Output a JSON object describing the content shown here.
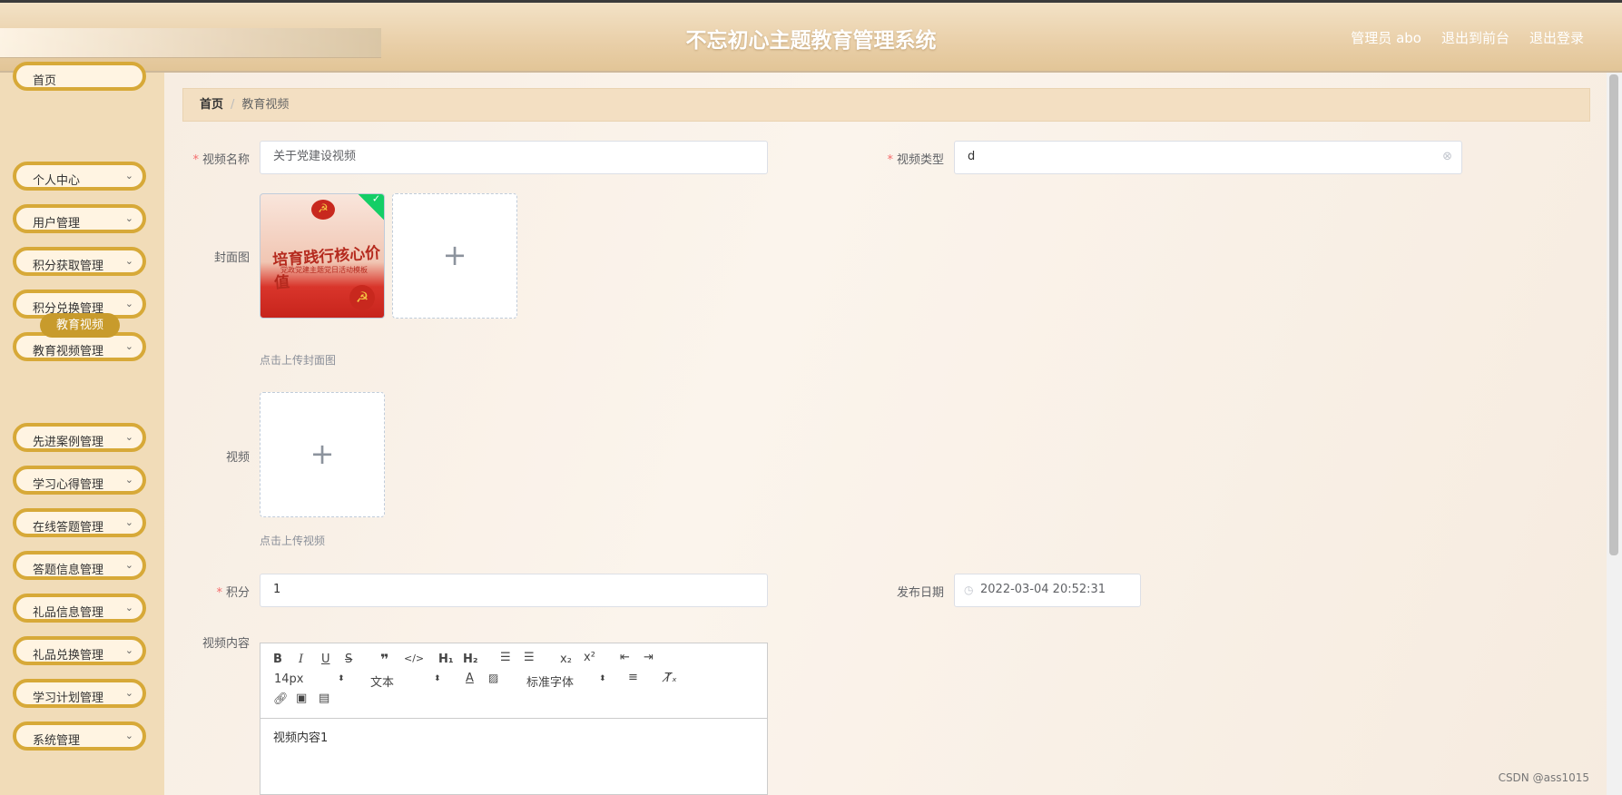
{
  "header": {
    "title": "不忘初心主题教育管理系统",
    "user_label": "管理员 abo",
    "to_front_label": "退出到前台",
    "logout_label": "退出登录"
  },
  "sidebar": {
    "items": [
      {
        "label": "首页"
      },
      {
        "label": "个人中心"
      },
      {
        "label": "用户管理"
      },
      {
        "label": "积分获取管理"
      },
      {
        "label": "积分兑换管理"
      },
      {
        "label": "教育视频管理"
      },
      {
        "label": "先进案例管理"
      },
      {
        "label": "学习心得管理"
      },
      {
        "label": "在线答题管理"
      },
      {
        "label": "答题信息管理"
      },
      {
        "label": "礼品信息管理"
      },
      {
        "label": "礼品兑换管理"
      },
      {
        "label": "学习计划管理"
      },
      {
        "label": "系统管理"
      }
    ],
    "active_sub": "教育视频",
    "chevron": "⌄"
  },
  "breadcrumb": {
    "home": "首页",
    "separator": "/",
    "current": "教育视频"
  },
  "form": {
    "required_mark": "*",
    "video_name_label": "视频名称",
    "video_name_value": "关于党建设视频",
    "video_type_label": "视频类型",
    "video_type_value": "d",
    "cover_label": "封面图",
    "cover_image_text": "培育践行核心价值",
    "cover_image_subtext": "党政党建主题党日活动模板",
    "cover_tip": "点击上传封面图",
    "video_label": "视频",
    "video_tip": "点击上传视频",
    "points_label": "积分",
    "points_value": "1",
    "publish_date_label": "发布日期",
    "publish_date_value": "2022-03-04 20:52:31",
    "content_label": "视频内容"
  },
  "editor": {
    "font_size": "14px",
    "block_format": "文本",
    "font_family": "标准字体",
    "content": "视频内容1"
  },
  "watermark": "CSDN @ass1015",
  "colors": {
    "accent": "#d7a938",
    "active": "#c89b2c",
    "required": "#f56c6c"
  }
}
